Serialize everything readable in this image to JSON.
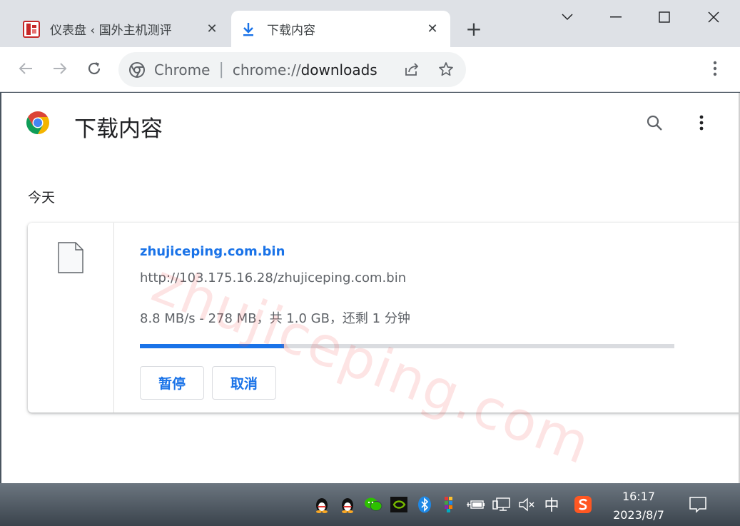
{
  "tabs": [
    {
      "title": "仪表盘 ‹ 国外主机测评",
      "favicon": "site-favicon",
      "close": "✕"
    },
    {
      "title": "下载内容",
      "favicon": "download-icon",
      "close": "✕"
    }
  ],
  "new_tab_symbol": "+",
  "omnibox": {
    "site_label": "Chrome",
    "separator": "|",
    "url_scheme": "chrome://",
    "url_rest": "downloads"
  },
  "page": {
    "title": "下载内容",
    "date_heading": "今天",
    "watermark": "zhujiceping.com"
  },
  "download": {
    "file_name": "zhujiceping.com.bin",
    "url": "http://103.175.16.28/zhujiceping.com.bin",
    "status": "8.8 MB/s - 278 MB，共 1.0 GB，还剩 1 分钟",
    "progress_fraction": 0.27,
    "pause_label": "暂停",
    "cancel_label": "取消"
  },
  "taskbar": {
    "time": "16:17",
    "date": "2023/8/7",
    "ime_label": "中"
  },
  "colors": {
    "accent": "#1a73e8",
    "tabstrip": "#dee1e6",
    "omnibox": "#f1f3f4"
  }
}
